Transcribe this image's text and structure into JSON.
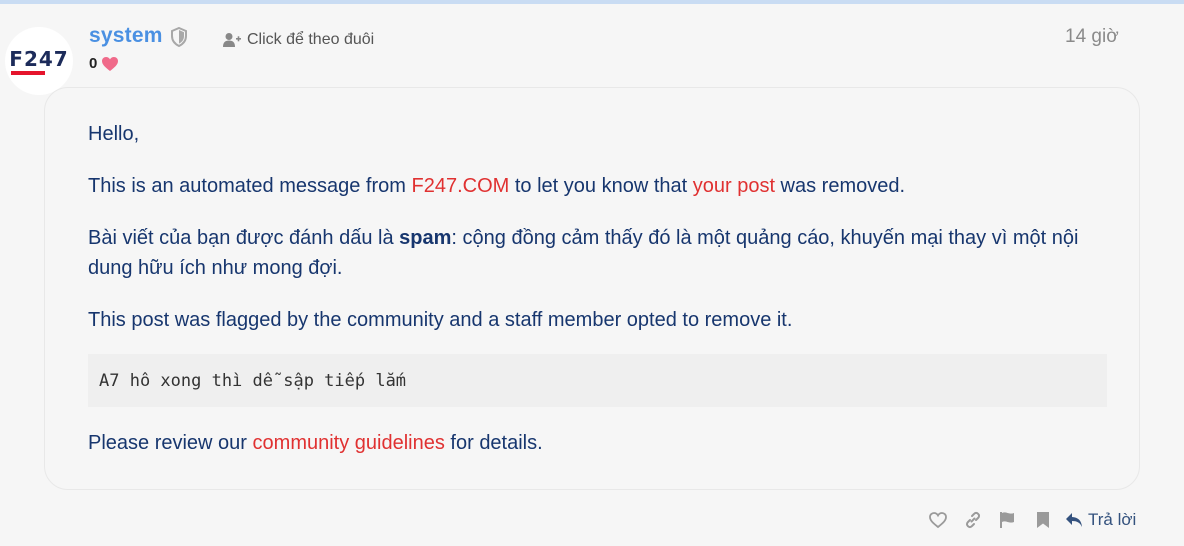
{
  "user": {
    "name": "system",
    "like_count": "0",
    "follow_label": "Click để theo đuôi",
    "avatar_text": "F247",
    "posted_time": "14 giờ"
  },
  "post": {
    "greeting": "Hello,",
    "line1": {
      "before": "This is an automated message from ",
      "site_link": "F247.COM",
      "middle": " to let you know that ",
      "post_link": "your post",
      "after": " was removed."
    },
    "line2": {
      "before": "Bài viết của bạn được đánh dấu là ",
      "flag": "spam",
      "after": ": cộng đồng cảm thấy đó là một quảng cáo, khuyến mại thay vì một nội dung hữu ích như mong đợi."
    },
    "line3": "This post was flagged by the community and a staff member opted to remove it.",
    "quoted_text": "A7 hô xong thì dễ sập tiếp lắm",
    "line4": {
      "before": "Please review our ",
      "guidelines_link": "community guidelines",
      "after": " for details."
    }
  },
  "actions": {
    "reply_label": "Trả lời",
    "icons": [
      "heart-outline-icon",
      "link-icon",
      "flag-icon",
      "bookmark-icon",
      "reply-icon"
    ]
  },
  "colors": {
    "username": "#4a90e2",
    "body_text": "#17366e",
    "link": "#e03131",
    "heart": "#f06a8a",
    "brand_red": "#e5142c",
    "brand_navy": "#1c2b5a"
  }
}
